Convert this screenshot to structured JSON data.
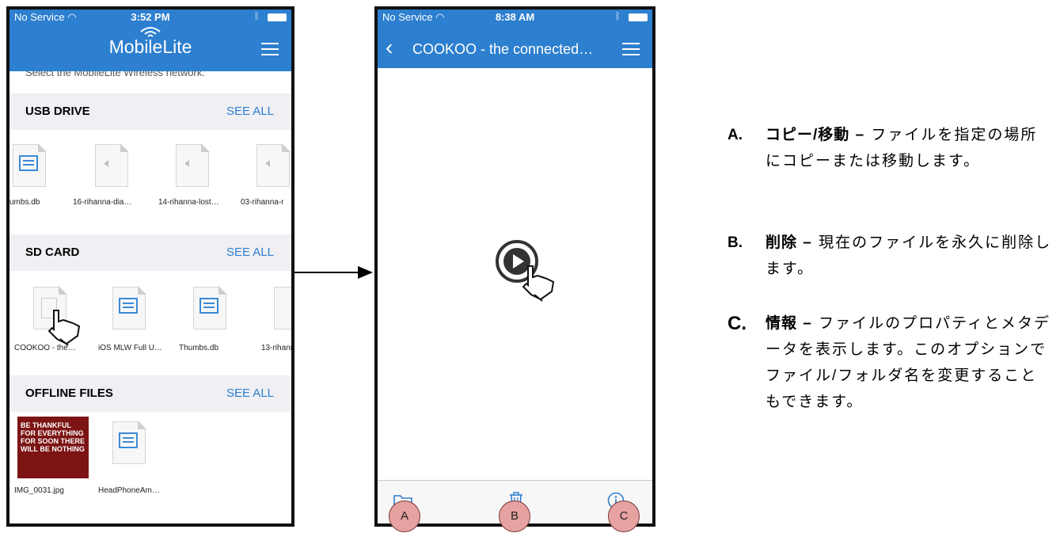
{
  "phone_left": {
    "status": {
      "carrier": "No Service",
      "time": "3:52 PM"
    },
    "brand": "MobileLite",
    "cut_text": "Select the MobileLite Wireless network.",
    "sections": [
      {
        "title": "USB DRIVE",
        "see_all": "SEE ALL",
        "files": [
          "umbs.db",
          "16-rihanna-dia…",
          "14-rihanna-lost…",
          "03-rihanna-r"
        ]
      },
      {
        "title": "SD CARD",
        "see_all": "SEE ALL",
        "files": [
          "COOKOO - the…",
          "iOS MLW Full U…",
          "Thumbs.db",
          "13-rihann"
        ]
      },
      {
        "title": "OFFLINE FILES",
        "see_all": "SEE ALL",
        "files": [
          "IMG_0031.jpg",
          "HeadPhoneAm…"
        ]
      }
    ],
    "thumbnail_text": "BE THANKFUL FOR EVERYTHING FOR SOON THERE WILL BE NOTHING"
  },
  "phone_right": {
    "status": {
      "carrier": "No Service",
      "time": "8:38 AM"
    },
    "title": "COOKOO - the connected…",
    "toolbar": {
      "copy_icon": "folder-icon",
      "delete_icon": "trash-icon",
      "info_icon": "info-icon"
    }
  },
  "callouts": [
    "A",
    "B",
    "C"
  ],
  "items": [
    {
      "letter": "A.",
      "term": "コピー/移動",
      "dash": "–",
      "text": "ファイルを指定の場所にコピーまたは移動します。"
    },
    {
      "letter": "B.",
      "term": "削除",
      "dash": "–",
      "text": "現在のファイルを永久に削除します。"
    },
    {
      "letter": "C.",
      "term": "情報",
      "dash": "–",
      "text": "ファイルのプロパティとメタデータを表示します。このオプションでファイル/フォルダ名を変更することもできます。"
    }
  ],
  "colors": {
    "accent": "#2d7fcf",
    "callout": "#e6a1a1",
    "section_bg": "#efeff4"
  }
}
